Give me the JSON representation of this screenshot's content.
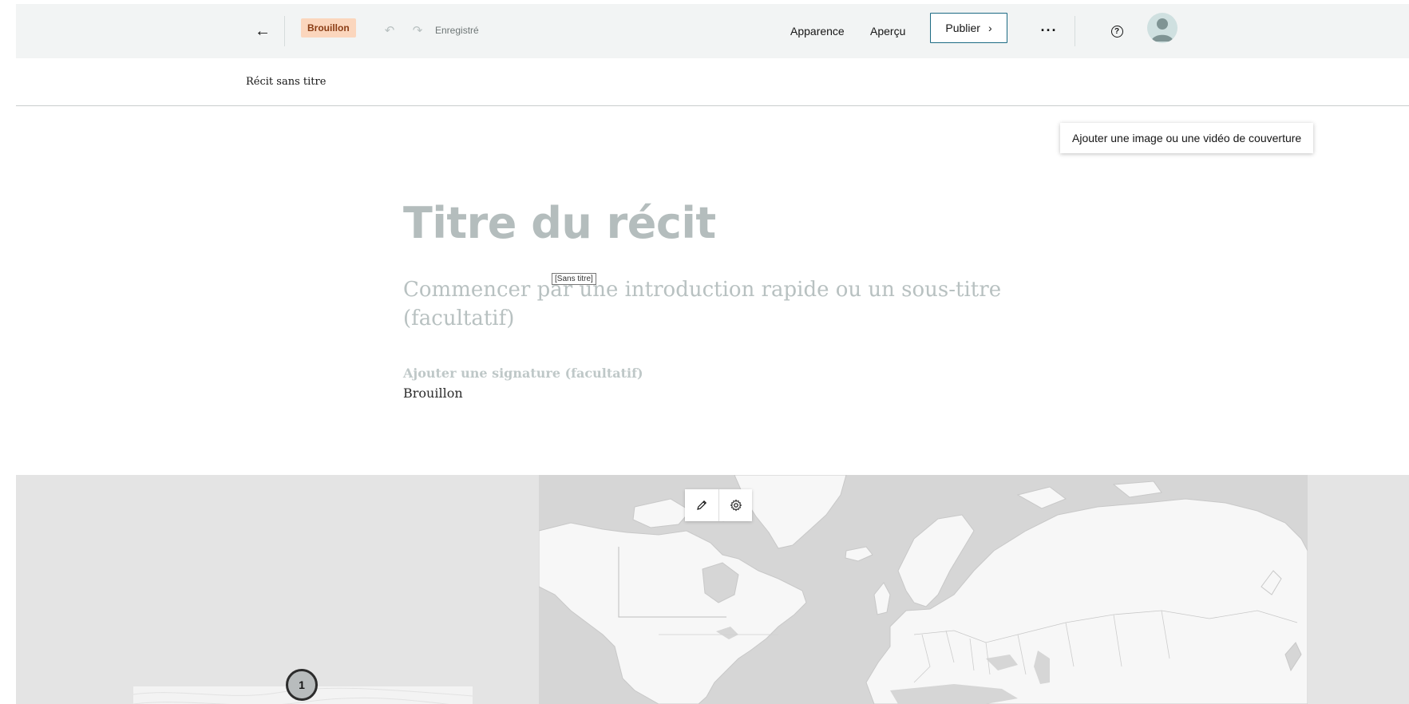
{
  "header": {
    "back_icon": "arrow-left-icon",
    "status_badge": "Brouillon",
    "saved_text": "Enregistré",
    "apparence_label": "Apparence",
    "apercu_label": "Aperçu",
    "publish_label": "Publier",
    "more_label": "···",
    "help_label": "?"
  },
  "titlebar": {
    "story_name": "Récit sans titre"
  },
  "cover": {
    "add_media_label": "Ajouter une image ou une vidéo de couverture",
    "title_placeholder": "Titre du récit",
    "subtitle_placeholder": "Commencer par une introduction rapide ou un sous-titre (facultatif)",
    "tooltip": "[Sans titre]",
    "byline_placeholder": "Ajouter une signature (facultatif)",
    "status_text": "Brouillon"
  },
  "map": {
    "marker_label": "1"
  },
  "colors": {
    "header_bg": "#f2f4f4",
    "badge_bg": "#fbd6bd",
    "publish_border": "#1c6a83",
    "placeholder": "#b4bdbd",
    "map_water": "#d6d6d6",
    "map_land": "#f7f7f7"
  }
}
